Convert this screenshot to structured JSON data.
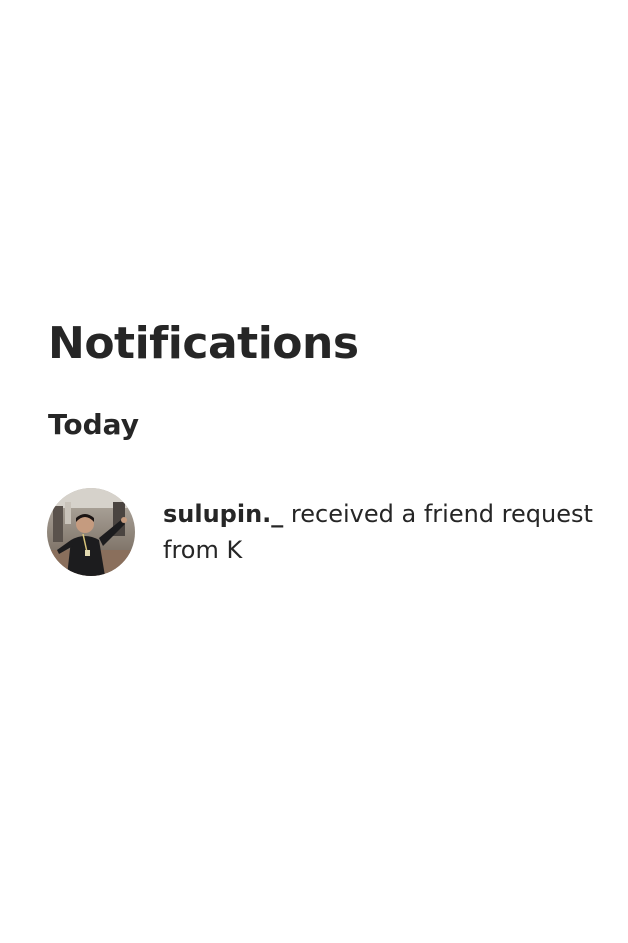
{
  "page": {
    "title": "Notifications"
  },
  "sections": [
    {
      "header": "Today",
      "items": [
        {
          "username": "sulupin._",
          "message": " received a friend request from K",
          "avatar_icon": "user-avatar-photo"
        }
      ]
    }
  ],
  "colors": {
    "text": "#262626",
    "background": "#ffffff"
  }
}
